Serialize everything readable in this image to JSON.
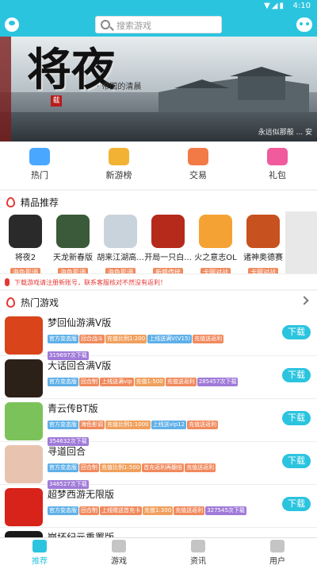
{
  "status": {
    "time": "4:10",
    "icons": "▼◢▮"
  },
  "header": {
    "search_placeholder": "搜索游戏"
  },
  "banner": {
    "title": "将夜",
    "seal": "载",
    "subtitle": "· 帝国的清晨",
    "credit": "永远似那般 ... 安"
  },
  "quicknav": [
    {
      "label": "热门",
      "color": "#49a7ff"
    },
    {
      "label": "新游榜",
      "color": "#f2b233"
    },
    {
      "label": "交易",
      "color": "#f27a46"
    },
    {
      "label": "礼包",
      "color": "#ef5b9c"
    }
  ],
  "featured_section": {
    "title": "精品推荐"
  },
  "featured": [
    {
      "name": "将夜2",
      "tag": "海色影调",
      "color": "#2a2a2a"
    },
    {
      "name": "天龙新春版",
      "tag": "海色影调",
      "color": "#3a5a3a"
    },
    {
      "name": "胡来江湖高...",
      "tag": "海色影调",
      "color": "#c9d3dc"
    },
    {
      "name": "开局一只白...",
      "tag": "新赣传统",
      "color": "#b52a1a"
    },
    {
      "name": "火之意志OL",
      "tag": "卡网对战",
      "color": "#f5a234"
    },
    {
      "name": "诸神奥德赛",
      "tag": "卡网对战",
      "color": "#c7521f"
    }
  ],
  "notice": {
    "text": "下载游戏请注册新账号，联系客服核对不然没有返利！"
  },
  "hot_section": {
    "title": "热门游戏"
  },
  "games": [
    {
      "name": "梦回仙游满V版",
      "color": "#d9441a",
      "download": "下载",
      "tags": [
        {
          "t": "官方变态版",
          "c": "#5fb0e8"
        },
        {
          "t": "回合战斗",
          "c": "#f08a5d"
        },
        {
          "t": "充值比例1:200",
          "c": "#f0a05d"
        },
        {
          "t": "上线送满V(V15)",
          "c": "#5fb0e8"
        },
        {
          "t": "充值送返利",
          "c": "#f08a5d"
        },
        {
          "t": "319697次下载",
          "c": "#a07ad8"
        }
      ]
    },
    {
      "name": "大话回合满V版",
      "color": "#2c2118",
      "download": "下载",
      "tags": [
        {
          "t": "官方变态版",
          "c": "#5fb0e8"
        },
        {
          "t": "回合制",
          "c": "#f08a5d"
        },
        {
          "t": "上线送满vip",
          "c": "#f08a5d"
        },
        {
          "t": "充值1:500",
          "c": "#f0a05d"
        },
        {
          "t": "充值送返利",
          "c": "#f08a5d"
        },
        {
          "t": "285457次下载",
          "c": "#a07ad8"
        }
      ]
    },
    {
      "name": "青云传BT版",
      "color": "#7cc25a",
      "download": "下载",
      "tags": [
        {
          "t": "官方变态版",
          "c": "#5fb0e8"
        },
        {
          "t": "海色影调",
          "c": "#f08a5d"
        },
        {
          "t": "充值比例1:1000",
          "c": "#f0a05d"
        },
        {
          "t": "上线送vip12",
          "c": "#5fb0e8"
        },
        {
          "t": "充值送返利",
          "c": "#f08a5d"
        },
        {
          "t": "354632次下载",
          "c": "#a07ad8"
        }
      ]
    },
    {
      "name": "寻道回合",
      "color": "#e8c4b0",
      "download": "下载",
      "tags": [
        {
          "t": "官方变态版",
          "c": "#5fb0e8"
        },
        {
          "t": "回合制",
          "c": "#f08a5d"
        },
        {
          "t": "充值比例1:500",
          "c": "#f0a05d"
        },
        {
          "t": "首充返利再翻倍",
          "c": "#f08a5d"
        },
        {
          "t": "充值送返利",
          "c": "#f08a5d"
        },
        {
          "t": "348527次下载",
          "c": "#a07ad8"
        }
      ]
    },
    {
      "name": "超梦西游无限版",
      "color": "#d8231a",
      "download": "下载",
      "tags": [
        {
          "t": "官方变态版",
          "c": "#5fb0e8"
        },
        {
          "t": "回合制",
          "c": "#f08a5d"
        },
        {
          "t": "上线赠送首充卡",
          "c": "#f08a5d"
        },
        {
          "t": "充值1:300",
          "c": "#f0a05d"
        },
        {
          "t": "充值送返利",
          "c": "#f08a5d"
        },
        {
          "t": "327545次下载",
          "c": "#a07ad8"
        }
      ]
    },
    {
      "name": "崩坏纪元重置版",
      "color": "#1a1a1a",
      "download": "下载",
      "tags": []
    }
  ],
  "tabs": [
    {
      "label": "推荐"
    },
    {
      "label": "游戏"
    },
    {
      "label": "资讯"
    },
    {
      "label": "用户"
    }
  ]
}
